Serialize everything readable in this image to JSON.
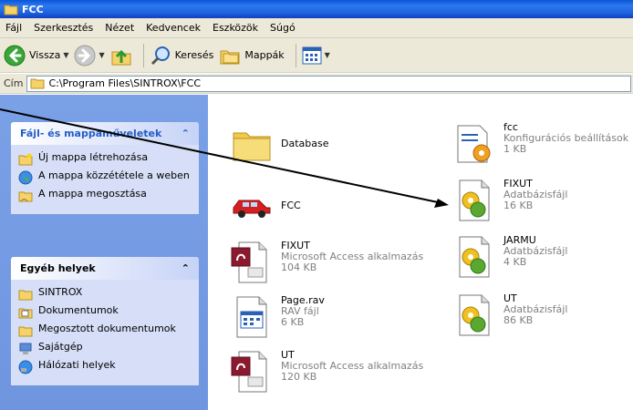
{
  "window": {
    "title": "FCC"
  },
  "menu": [
    "Fájl",
    "Szerkesztés",
    "Nézet",
    "Kedvencek",
    "Eszközök",
    "Súgó"
  ],
  "toolbar": {
    "back": "Vissza",
    "search": "Keresés",
    "folders": "Mappák"
  },
  "address": {
    "label": "Cím",
    "path": "C:\\Program Files\\SINTROX\\FCC"
  },
  "tasks": {
    "title": "Fájl- és mappaműveletek",
    "items": [
      "Új mappa létrehozása",
      "A mappa közzététele a weben",
      "A mappa megosztása"
    ]
  },
  "places": {
    "title": "Egyéb helyek",
    "items": [
      "SINTROX",
      "Dokumentumok",
      "Megosztott dokumentumok",
      "Sajátgép",
      "Hálózati helyek"
    ]
  },
  "files": [
    {
      "name": "Database",
      "type": "",
      "size": ""
    },
    {
      "name": "FCC",
      "type": "",
      "size": ""
    },
    {
      "name": "FIXUT",
      "type": "Microsoft Access alkalmazás",
      "size": "104 KB"
    },
    {
      "name": "Page.rav",
      "type": "RAV fájl",
      "size": "6 KB"
    },
    {
      "name": "UT",
      "type": "Microsoft Access alkalmazás",
      "size": "120 KB"
    },
    {
      "name": "fcc",
      "type": "Konfigurációs beállítások",
      "size": "1 KB"
    },
    {
      "name": "FIXUT",
      "type": "Adatbázisfájl",
      "size": "16 KB"
    },
    {
      "name": "JARMU",
      "type": "Adatbázisfájl",
      "size": "4 KB"
    },
    {
      "name": "UT",
      "type": "Adatbázisfájl",
      "size": "86 KB"
    }
  ],
  "colors": {
    "titlebar": "#1f63e0",
    "leftpane": "#7aa1e6",
    "taskhead": "#215dc6"
  }
}
